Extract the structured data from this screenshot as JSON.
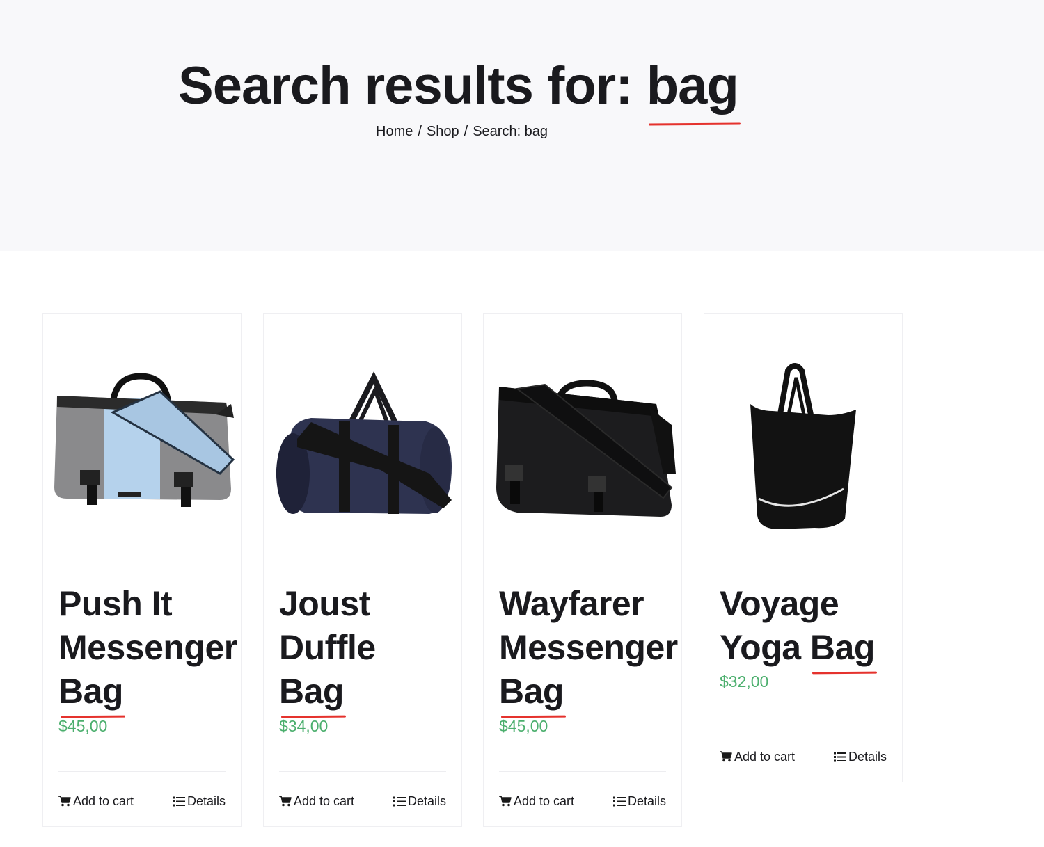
{
  "header": {
    "title_prefix": "Search results for: ",
    "title_query": "bag",
    "breadcrumb": [
      "Home",
      "Shop",
      "Search: bag"
    ],
    "breadcrumb_separator": "/"
  },
  "products": [
    {
      "name_lines": [
        "Push It",
        "Messenger"
      ],
      "name_highlight": "Bag",
      "price": "$45,00",
      "add_to_cart": "Add to cart",
      "details": "Details",
      "image_icon": "messenger-bag-gray-blue"
    },
    {
      "name_lines": [
        "Joust",
        "Duffle"
      ],
      "name_highlight": "Bag",
      "price": "$34,00",
      "add_to_cart": "Add to cart",
      "details": "Details",
      "image_icon": "duffle-bag-navy"
    },
    {
      "name_lines": [
        "Wayfarer",
        "Messenger"
      ],
      "name_highlight": "Bag",
      "price": "$45,00",
      "add_to_cart": "Add to cart",
      "details": "Details",
      "image_icon": "messenger-bag-black"
    },
    {
      "name_lines": [
        "Voyage"
      ],
      "name_prefix_last": "Yoga ",
      "name_highlight": "Bag",
      "price": "$32,00",
      "add_to_cart": "Add to cart",
      "details": "Details",
      "image_icon": "tote-bag-black"
    }
  ],
  "colors": {
    "price": "#4caf6e",
    "highlight_underline": "#e5322d",
    "hero_bg": "#f8f8fa"
  }
}
